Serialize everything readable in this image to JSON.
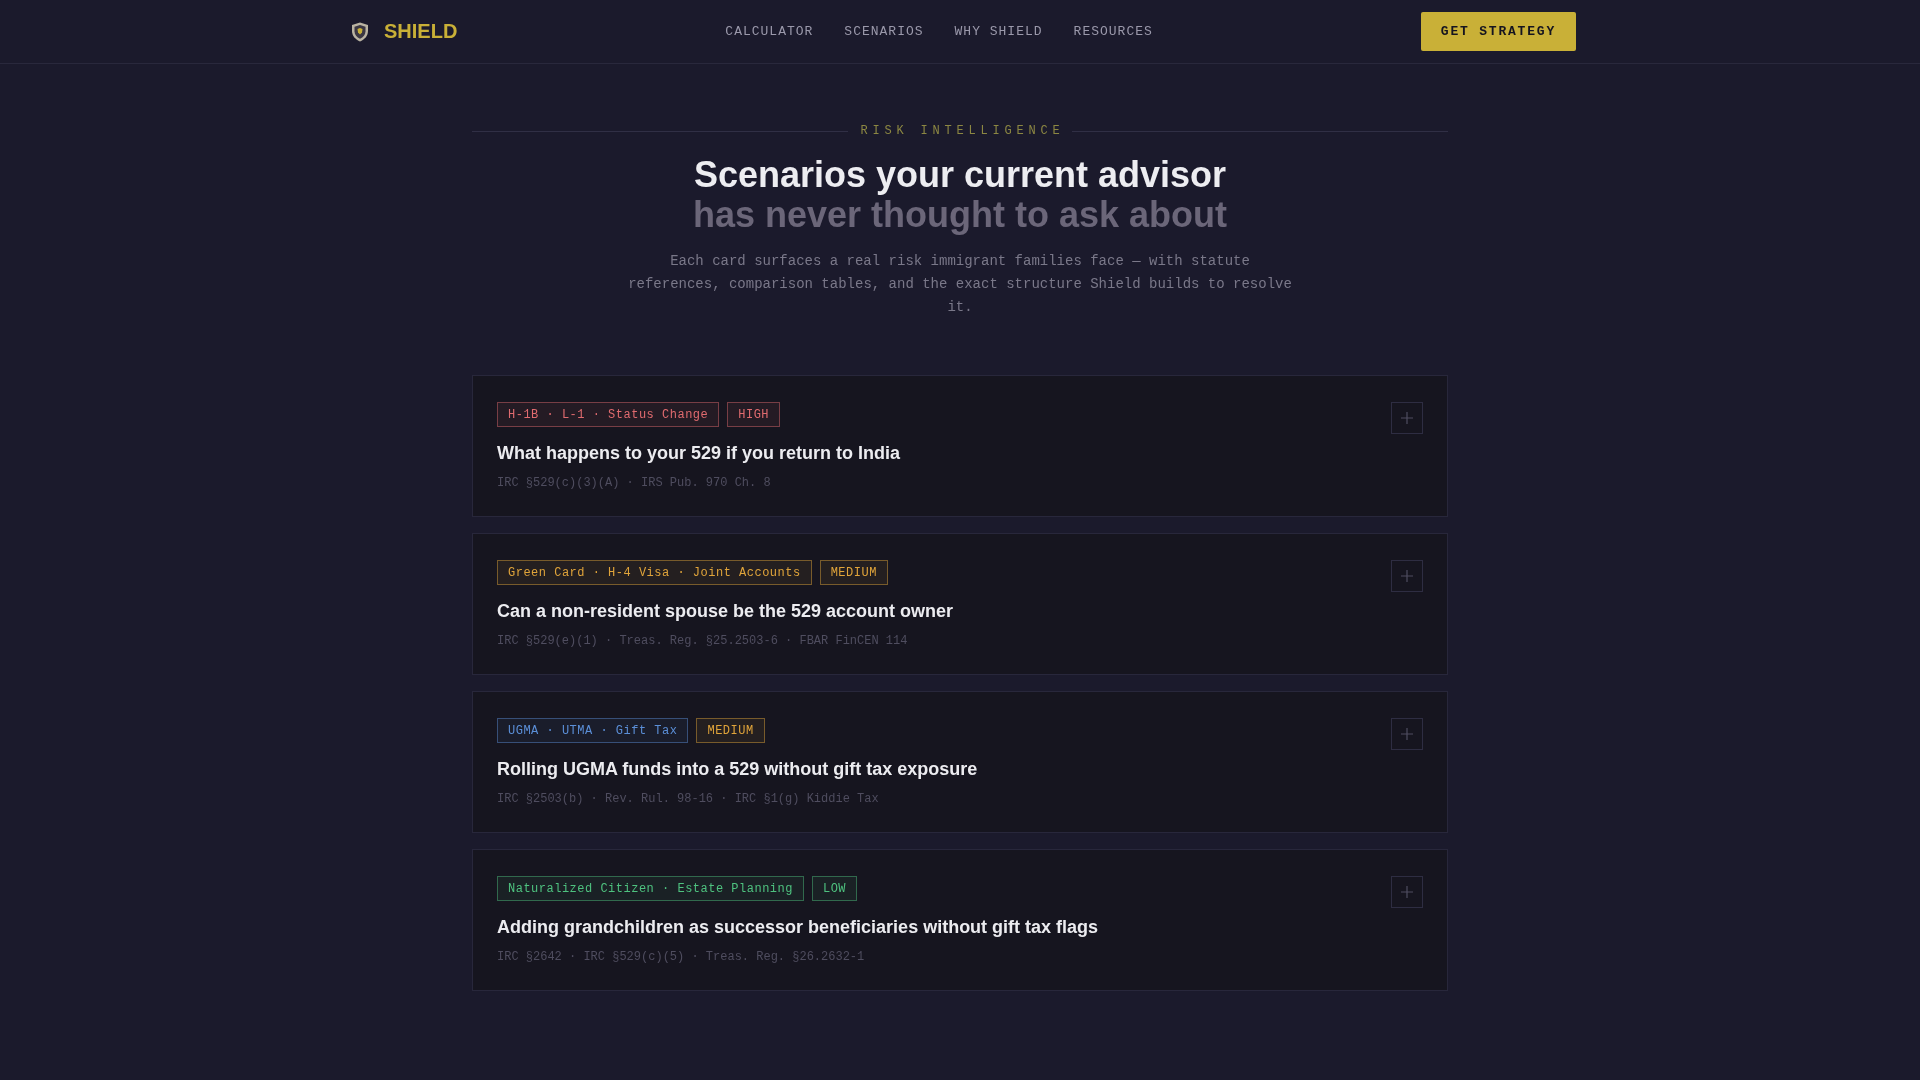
{
  "nav": {
    "brand": "SHIELD",
    "links": [
      "CALCULATOR",
      "SCENARIOS",
      "WHY SHIELD",
      "RESOURCES"
    ],
    "cta": "GET STRATEGY"
  },
  "hero": {
    "eyebrow": "RISK INTELLIGENCE",
    "heading_lines": [
      {
        "text": "Scenarios your current advisor",
        "muted": false
      },
      {
        "text": "has never thought to ask about",
        "muted": true
      }
    ],
    "description": "Each card surfaces a real risk immigrant families face — with statute references, comparison tables, and the exact structure Shield builds to resolve it."
  },
  "cards": [
    {
      "tags": [
        {
          "label": "H-1B · L-1 · Status Change",
          "color": "#e06b6f"
        },
        {
          "label": "HIGH",
          "color": "#e06b6f"
        }
      ],
      "title": "What happens to your 529 if you return to India",
      "references": "IRC §529(c)(3)(A) · IRS Pub. 970 Ch. 8",
      "expanded": false
    },
    {
      "tags": [
        {
          "label": "Green Card · H-4 Visa · Joint Accounts",
          "color": "#e0a43a"
        },
        {
          "label": "MEDIUM",
          "color": "#e0a43a"
        }
      ],
      "title": "Can a non-resident spouse be the 529 account owner",
      "references": "IRC §529(e)(1) · Treas. Reg. §25.2503-6 · FBAR FinCEN 114",
      "expanded": false
    },
    {
      "tags": [
        {
          "label": "UGMA · UTMA · Gift Tax",
          "color": "#5b8fd8"
        },
        {
          "label": "MEDIUM",
          "color": "#e0a43a"
        }
      ],
      "title": "Rolling UGMA funds into a 529 without gift tax exposure",
      "references": "IRC §2503(b) · Rev. Rul. 98-16 · IRC §1(g) Kiddie Tax",
      "expanded": false
    },
    {
      "tags": [
        {
          "label": "Naturalized Citizen · Estate Planning",
          "color": "#4ec27f"
        },
        {
          "label": "LOW",
          "color": "#4ec27f"
        }
      ],
      "title": "Adding grandchildren as successor beneficiaries without gift tax flags",
      "references": "IRC §2642 · IRC §529(c)(5) · Treas. Reg. §26.2632-1",
      "expanded": false
    }
  ]
}
